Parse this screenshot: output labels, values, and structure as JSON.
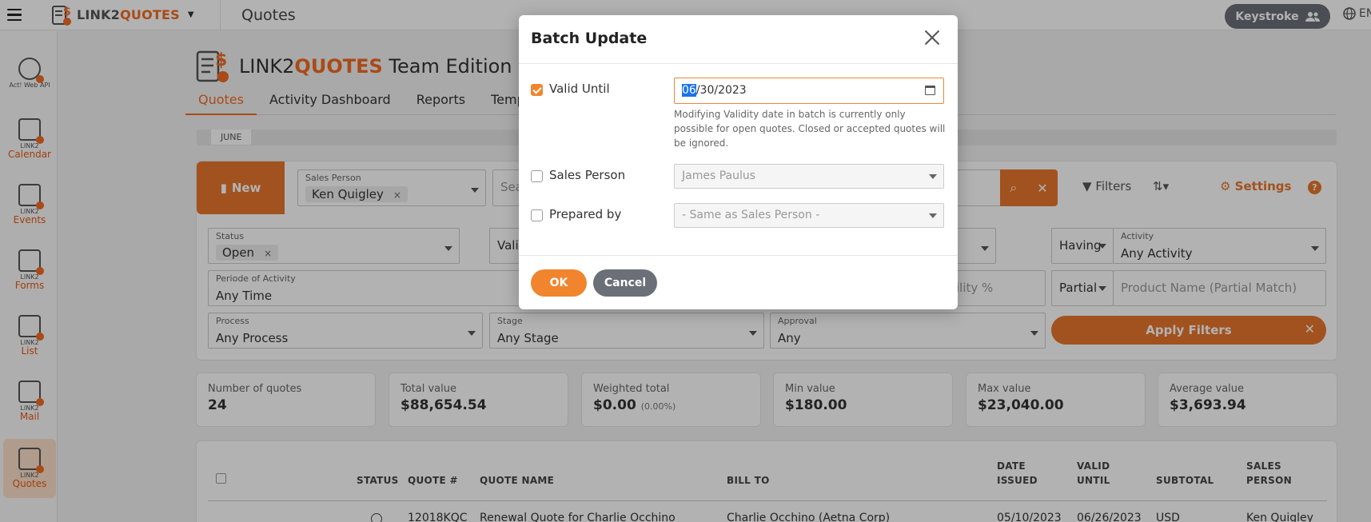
{
  "topbar": {
    "brand_prefix": "LINK2",
    "brand_highlight": "QUOTES",
    "breadcrumb": "Quotes",
    "user_label": "Keystroke",
    "lang": "EN"
  },
  "sidebar": {
    "items": [
      {
        "small": "Act! Web API",
        "label": ""
      },
      {
        "small": "LINK2",
        "label": "Calendar"
      },
      {
        "small": "LINK2",
        "label": "Events"
      },
      {
        "small": "LINK2",
        "label": "Forms"
      },
      {
        "small": "LINK2",
        "label": "List"
      },
      {
        "small": "LINK2",
        "label": "Mail"
      },
      {
        "small": "LINK2",
        "label": "Quotes"
      }
    ]
  },
  "app": {
    "title_prefix": "LINK2",
    "title_highlight": "QUOTES",
    "title_suffix": "Team Edition",
    "tabs": [
      "Quotes",
      "Activity Dashboard",
      "Reports",
      "Templ"
    ]
  },
  "timeline": {
    "month": "JUNE"
  },
  "filters": {
    "new_label": "New",
    "sales_person_label": "Sales Person",
    "sales_person_value": "Ken Quigley",
    "search_placeholder": "Sea",
    "filters_label": "Filters",
    "settings_label": "Settings",
    "help": "?",
    "status_label": "Status",
    "status_value": "Open",
    "validity_partial": "Vali",
    "having_label": "Having",
    "activity_label": "Activity",
    "activity_value": "Any Activity",
    "period_label": "Periode of Activity",
    "period_value": "Any Time",
    "probability_partial": "ility %",
    "partial_label": "Partial",
    "product_placeholder": "Product Name (Partial Match)",
    "process_label": "Process",
    "process_value": "Any Process",
    "stage_label": "Stage",
    "stage_value": "Any Stage",
    "approval_label": "Approval",
    "approval_value": "Any",
    "apply_label": "Apply Filters"
  },
  "stats": [
    {
      "label": "Number of quotes",
      "value": "24",
      "extra": ""
    },
    {
      "label": "Total value",
      "value": "$88,654.54",
      "extra": ""
    },
    {
      "label": "Weighted total",
      "value": "$0.00",
      "extra": "(0.00%)"
    },
    {
      "label": "Min value",
      "value": "$180.00",
      "extra": ""
    },
    {
      "label": "Max value",
      "value": "$23,040.00",
      "extra": ""
    },
    {
      "label": "Average value",
      "value": "$3,693.94",
      "extra": ""
    }
  ],
  "table": {
    "headers": {
      "status": "STATUS",
      "quote_no": "QUOTE #",
      "quote_name": "QUOTE NAME",
      "bill_to": "BILL TO",
      "date_issued_1": "DATE",
      "date_issued_2": "ISSUED",
      "valid_until_1": "VALID",
      "valid_until_2": "UNTIL",
      "subtotal": "SUBTOTAL",
      "sales_person_1": "SALES",
      "sales_person_2": "PERSON"
    },
    "row": {
      "quote_no": "12018KQC",
      "quote_name": "Renewal Quote for Charlie Occhino",
      "bill_to": "Charlie Occhino (Aetna Corp)",
      "date_issued": "05/10/2023",
      "valid_until": "06/26/2023",
      "subtotal": "USD",
      "sales_person": "Ken Quigley"
    }
  },
  "modal": {
    "title": "Batch Update",
    "valid_until_label": "Valid Until",
    "valid_until_checked": true,
    "date_selected": "06",
    "date_rest": "/30/2023",
    "hint": "Modifying Validity date in batch is currently only possible for open quotes. Closed or accepted quotes will be ignored.",
    "sales_person_label": "Sales Person",
    "sales_person_value": "James Paulus",
    "prepared_by_label": "Prepared by",
    "prepared_by_value": "- Same as Sales Person -",
    "ok_label": "OK",
    "cancel_label": "Cancel"
  },
  "colors": {
    "accent": "#f0852e",
    "secondary_button": "#6b6f78"
  }
}
